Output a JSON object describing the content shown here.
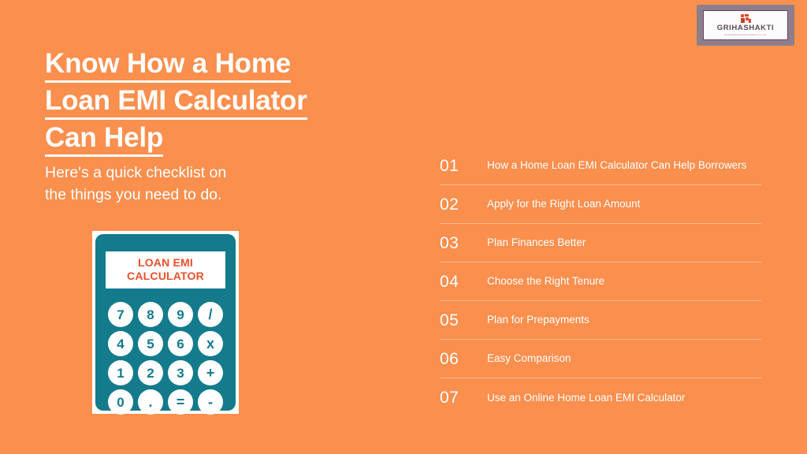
{
  "theme": {
    "background": "#fa8f4e",
    "text_on_background": "#ffffff",
    "calculator_body": "#137b8c",
    "calculator_accent": "#e8502b",
    "divider": "rgba(255,255,255,0.38)"
  },
  "logo": {
    "wordmark": "GRIHASHAKTI",
    "tagline": "Poonawalla Housing Finance Co. Ltd.",
    "mark_name": "grihashakti-squares-mark"
  },
  "headline": {
    "line1": "Know How a Home",
    "line2": "Loan EMI Calculator",
    "line3": "Can Help"
  },
  "subtitle": {
    "line1": "Here's a quick checklist on",
    "line2": "the things you need to do."
  },
  "calculator": {
    "display_line1": "LOAN EMI",
    "display_line2": "CALCULATOR",
    "keys": [
      {
        "label": "7",
        "type": "digit"
      },
      {
        "label": "8",
        "type": "digit"
      },
      {
        "label": "9",
        "type": "digit"
      },
      {
        "label": "/",
        "type": "operator"
      },
      {
        "label": "4",
        "type": "digit"
      },
      {
        "label": "5",
        "type": "digit"
      },
      {
        "label": "6",
        "type": "digit"
      },
      {
        "label": "x",
        "type": "operator"
      },
      {
        "label": "1",
        "type": "digit"
      },
      {
        "label": "2",
        "type": "digit"
      },
      {
        "label": "3",
        "type": "digit"
      },
      {
        "label": "+",
        "type": "operator"
      },
      {
        "label": "0",
        "type": "digit"
      },
      {
        "label": ".",
        "type": "decimal"
      },
      {
        "label": "=",
        "type": "equals"
      },
      {
        "label": "-",
        "type": "operator"
      }
    ]
  },
  "checklist": {
    "items": [
      {
        "number": "01",
        "label": "How a Home Loan EMI Calculator Can Help Borrowers"
      },
      {
        "number": "02",
        "label": "Apply for the Right Loan Amount"
      },
      {
        "number": "03",
        "label": "Plan Finances Better"
      },
      {
        "number": "04",
        "label": "Choose the Right Tenure"
      },
      {
        "number": "05",
        "label": "Plan for Prepayments"
      },
      {
        "number": "06",
        "label": "Easy Comparison"
      },
      {
        "number": "07",
        "label": "Use an Online Home Loan EMI Calculator"
      }
    ]
  }
}
